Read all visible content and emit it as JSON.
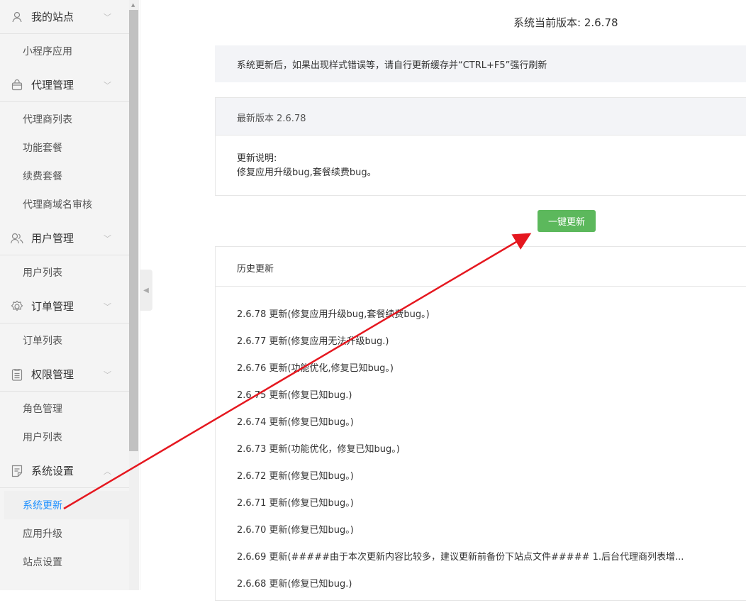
{
  "sidebar": {
    "groups": [
      {
        "label": "我的站点",
        "icon": "user-icon",
        "items": [
          "小程序应用"
        ]
      },
      {
        "label": "代理管理",
        "icon": "bag-icon",
        "items": [
          "代理商列表",
          "功能套餐",
          "续费套餐",
          "代理商域名审核"
        ]
      },
      {
        "label": "用户管理",
        "icon": "users-icon",
        "items": [
          "用户列表"
        ]
      },
      {
        "label": "订单管理",
        "icon": "gear-icon",
        "items": [
          "订单列表"
        ]
      },
      {
        "label": "权限管理",
        "icon": "clipboard-icon",
        "items": [
          "角色管理",
          "用户列表"
        ]
      },
      {
        "label": "系统设置",
        "icon": "document-icon",
        "items": [
          "系统更新",
          "应用升级",
          "站点设置"
        ]
      }
    ]
  },
  "main": {
    "current_version": "系统当前版本: 2.6.78",
    "notice": "系统更新后，如果出现样式错误等，请自行更新缓存并“CTRL+F5”强行刷新",
    "latest_title": "最新版本 2.6.78",
    "latest_desc_label": "更新说明:",
    "latest_desc": "修复应用升级bug,套餐续费bug。",
    "update_button": "一键更新",
    "history_title": "历史更新",
    "history": [
      "2.6.78 更新(修复应用升级bug,套餐续费bug。)",
      "2.6.77 更新(修复应用无法升级bug.)",
      "2.6.76 更新(功能优化,修复已知bug。)",
      "2.6.75 更新(修复已知bug.)",
      "2.6.74 更新(修复已知bug。)",
      "2.6.73 更新(功能优化，修复已知bug。)",
      "2.6.72 更新(修复已知bug。)",
      "2.6.71 更新(修复已知bug。)",
      "2.6.70 更新(修复已知bug。)",
      "2.6.69 更新(#####由于本次更新内容比较多，建议更新前备份下站点文件##### 1.后台代理商列表增...",
      "2.6.68 更新(修复已知bug.)"
    ]
  },
  "colors": {
    "accent": "#1e90ff",
    "button": "#5cb85c",
    "arrow": "#e5171f"
  }
}
